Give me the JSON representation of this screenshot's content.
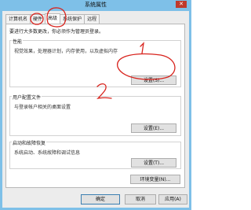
{
  "window": {
    "title": "系统属性",
    "close_glyph": "✕"
  },
  "tabs": [
    {
      "label": "计算机名"
    },
    {
      "label": "硬件"
    },
    {
      "label": "高级"
    },
    {
      "label": "系统保护"
    },
    {
      "label": "远程"
    }
  ],
  "active_tab_index": 2,
  "panel": {
    "note": "要进行大多数更改，你必须作为管理员登录。",
    "performance": {
      "label": "性能",
      "description": "视觉效果，处理器计划，内存使用，以及虚拟内存",
      "button": "设置(S)..."
    },
    "user_profiles": {
      "label": "用户配置文件",
      "description": "与登录帐户相关的桌面设置",
      "button": "设置(E)..."
    },
    "startup_recovery": {
      "label": "启动和故障恢复",
      "description": "系统启动、系统故障和调试信息",
      "button": "设置(T)..."
    },
    "env_button": "环境变量(N)..."
  },
  "footer": {
    "ok": "确定",
    "cancel": "取消",
    "apply": "应用(A)"
  },
  "annotations": {
    "mark_1": "1",
    "mark_2": "2",
    "color": "#d8231d"
  }
}
